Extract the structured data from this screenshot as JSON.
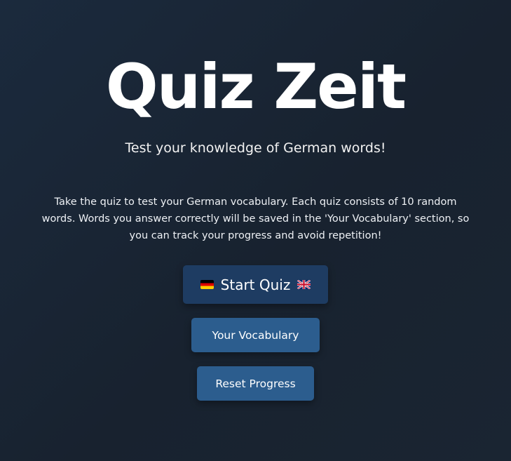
{
  "hero": {
    "title": "Quiz Zeit",
    "subtitle": "Test your knowledge of German words!"
  },
  "intro": {
    "text": "Take the quiz to test your German vocabulary. Each quiz consists of 10 random words. Words you answer correctly will be saved in the 'Your Vocabulary' section, so you can track your progress and avoid repetition!"
  },
  "actions": {
    "start_label": "Start Quiz",
    "start_left_icon": "german-flag-icon",
    "start_right_icon": "uk-flag-icon",
    "vocabulary_label": "Your Vocabulary",
    "reset_label": "Reset Progress"
  },
  "colors": {
    "background": "#1b2633",
    "start_button": "#1e3c62",
    "secondary_button": "#2c5d8e",
    "text": "#ffffff"
  }
}
